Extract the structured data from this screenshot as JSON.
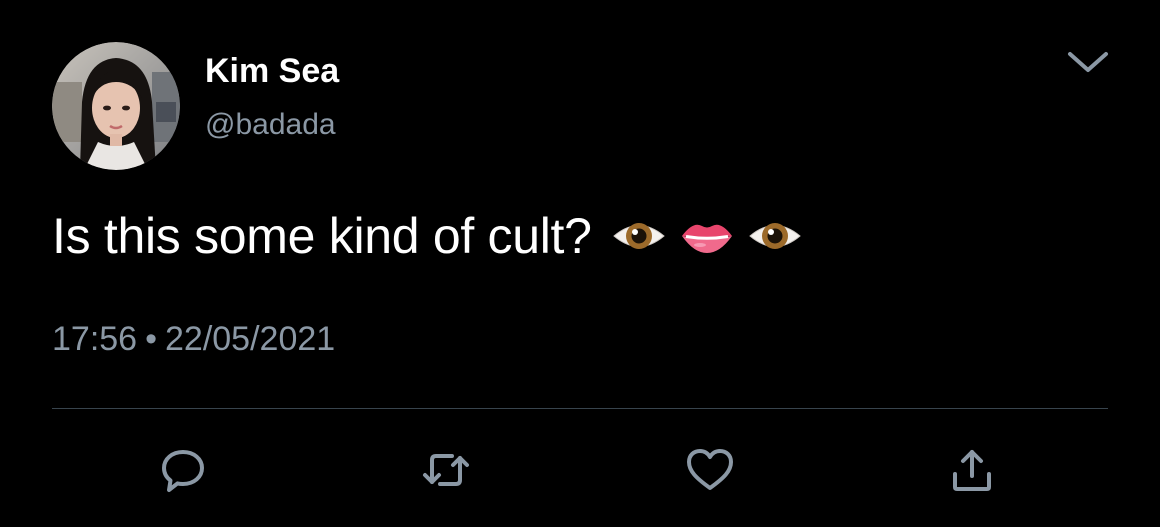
{
  "tweet": {
    "author": {
      "display_name": "Kim Sea",
      "handle": "@badada",
      "avatar_icon": "profile-photo"
    },
    "text": "Is this some kind of cult?",
    "emojis": [
      "eye",
      "lips",
      "eye"
    ],
    "time": "17:56",
    "separator": "•",
    "date": "22/05/2021"
  },
  "actions": [
    {
      "name": "reply",
      "icon": "speech-bubble-icon"
    },
    {
      "name": "retweet",
      "icon": "retweet-arrows-icon"
    },
    {
      "name": "like",
      "icon": "heart-icon"
    },
    {
      "name": "share",
      "icon": "share-upload-icon"
    }
  ],
  "colors": {
    "background": "#000000",
    "primary_text": "#ffffff",
    "secondary_text": "#8b98a5",
    "divider": "#38444d",
    "icon": "#8b98a5"
  }
}
